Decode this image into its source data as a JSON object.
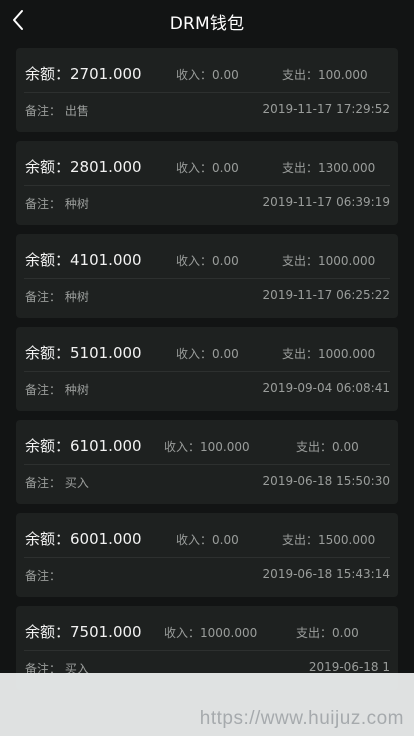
{
  "header": {
    "title": "DRM钱包",
    "back_icon": "chevron-left-icon"
  },
  "records": [
    {
      "balance": "余额：2701.000",
      "income": "收入：0.00",
      "expense": "支出：100.000",
      "remark": "备注：  出售",
      "time": "2019-11-17 17:29:52"
    },
    {
      "balance": "余额：2801.000",
      "income": "收入：0.00",
      "expense": "支出：1300.000",
      "remark": "备注：  种树",
      "time": "2019-11-17 06:39:19"
    },
    {
      "balance": "余额：4101.000",
      "income": "收入：0.00",
      "expense": "支出：1000.000",
      "remark": "备注：  种树",
      "time": "2019-11-17 06:25:22"
    },
    {
      "balance": "余额：5101.000",
      "income": "收入：0.00",
      "expense": "支出：1000.000",
      "remark": "备注：  种树",
      "time": "2019-09-04 06:08:41"
    },
    {
      "balance": "余额：6101.000",
      "income": "收入：100.000",
      "expense": "支出：0.00",
      "remark": "备注：  买入",
      "time": "2019-06-18 15:50:30"
    },
    {
      "balance": "余额：6001.000",
      "income": "收入：0.00",
      "expense": "支出：1500.000",
      "remark": "备注：",
      "time": "2019-06-18 15:43:14"
    },
    {
      "balance": "余额：7501.000",
      "income": "收入：1000.000",
      "expense": "支出：0.00",
      "remark": "备注：  买入",
      "time": "2019-06-18 1"
    }
  ],
  "watermark": {
    "text": "https://www.huijuz.com"
  },
  "colors": {
    "background": "#121414",
    "card": "#1e2120",
    "text_primary": "#f2f2f2",
    "text_secondary": "#9a9d9b"
  }
}
